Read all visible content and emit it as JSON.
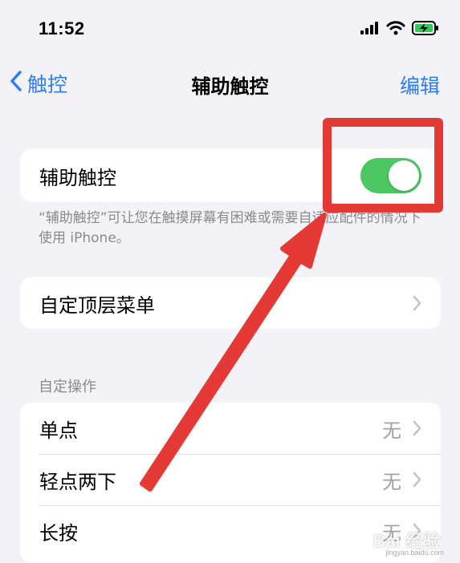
{
  "status_bar": {
    "time": "11:52"
  },
  "nav": {
    "back_label": "触控",
    "title": "辅助触控",
    "edit_label": "编辑"
  },
  "assistive_touch": {
    "label": "辅助触控",
    "enabled": true,
    "description": "“辅助触控”可让您在触摸屏幕有困难或需要自适应配件的情况下使用 iPhone。"
  },
  "top_menu": {
    "label": "自定顶层菜单"
  },
  "custom_actions": {
    "header": "自定操作",
    "rows": [
      {
        "label": "单点",
        "value": "无"
      },
      {
        "label": "轻点两下",
        "value": "无"
      },
      {
        "label": "长按",
        "value": "无"
      }
    ]
  },
  "watermark": {
    "text": "Bai 经验",
    "sub": "jingyan.baidu.com"
  },
  "colors": {
    "accent": "#2f7cf6",
    "toggle_on": "#4cc764",
    "annotation": "#e53935"
  }
}
